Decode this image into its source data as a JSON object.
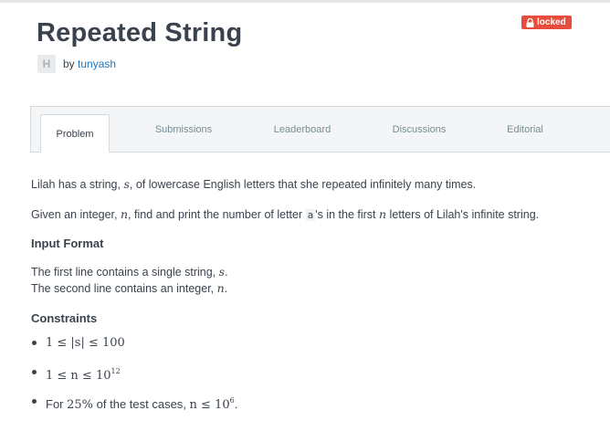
{
  "challenge": {
    "title": "Repeated String",
    "status_badge": "locked",
    "author_prefix": "by",
    "author_name": "tunyash",
    "avatar_letter": "H"
  },
  "tabs": [
    {
      "label": "Problem",
      "active": true
    },
    {
      "label": "Submissions",
      "active": false
    },
    {
      "label": "Leaderboard",
      "active": false
    },
    {
      "label": "Discussions",
      "active": false
    },
    {
      "label": "Editorial",
      "active": false
    }
  ],
  "problem": {
    "intro_pre": "Lilah has a string, ",
    "intro_var": "s",
    "intro_post": ", of lowercase English letters that she repeated infinitely many times.",
    "task_pre": "Given an integer, ",
    "task_var": "n",
    "task_mid": ", find and print the number of letter ",
    "task_code": "a",
    "task_mid2": "'s in the first ",
    "task_var2": "n",
    "task_post": " letters of Lilah's infinite string.",
    "input_heading": "Input Format",
    "input_line1_pre": "The first line contains a single string, ",
    "input_line1_var": "s",
    "input_line1_post": ".",
    "input_line2_pre": "The second line contains an integer, ",
    "input_line2_var": "n",
    "input_line2_post": ".",
    "constraints_heading": "Constraints",
    "constraint1": "1 ≤ |s| ≤ 100",
    "constraint2_base": "1 ≤ n ≤ 10",
    "constraint2_exp": "12",
    "constraint3_pre": "For ",
    "constraint3_pct": "25%",
    "constraint3_mid": " of the test cases, ",
    "constraint3_math": "n ≤ 10",
    "constraint3_exp": "6",
    "constraint3_post": "."
  },
  "colors": {
    "badge": "#e74c3c",
    "link": "#1d78c1",
    "text": "#39424e"
  }
}
